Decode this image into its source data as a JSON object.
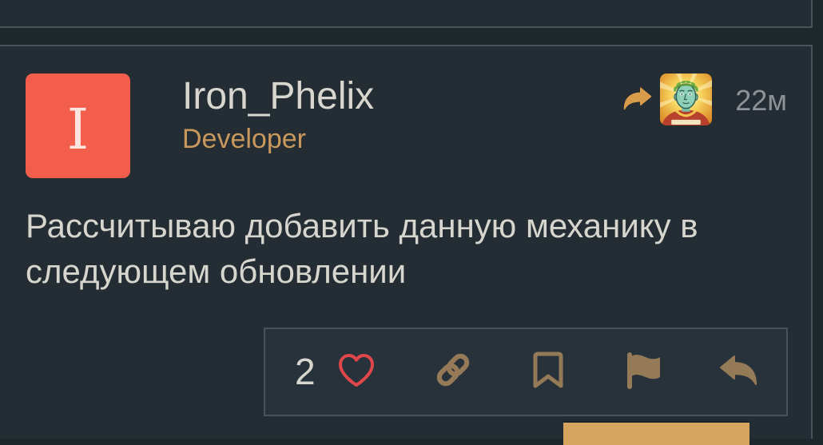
{
  "colors": {
    "page_bg": "#232d33",
    "gap_bg": "#1e272c",
    "border": "#48525a",
    "avatar_bg": "#f25e4b",
    "avatar_letter": "#fde5df",
    "username": "#d8d6ce",
    "user_title": "#c8985c",
    "muted": "#8c9297",
    "body_text": "#d6d6cf",
    "accent": "#d99c4a",
    "like_heart": "#e0474a",
    "action_icon": "#947a56",
    "action_bar_bg": "#27323a",
    "primary_button": "#d5a55f"
  },
  "post": {
    "author": {
      "avatar_letter": "I",
      "username": "Iron_Phelix",
      "title": "Developer"
    },
    "reply_to": {
      "arrow_icon": "reply-to-arrow-icon"
    },
    "age": "22м",
    "body": "Рассчитываю добавить данную механику в следующем обновлении",
    "actions": {
      "like_count": "2",
      "icons": {
        "like": "heart-icon",
        "link": "link-icon",
        "bookmark": "bookmark-icon",
        "flag": "flag-icon",
        "reply": "reply-icon"
      }
    }
  }
}
